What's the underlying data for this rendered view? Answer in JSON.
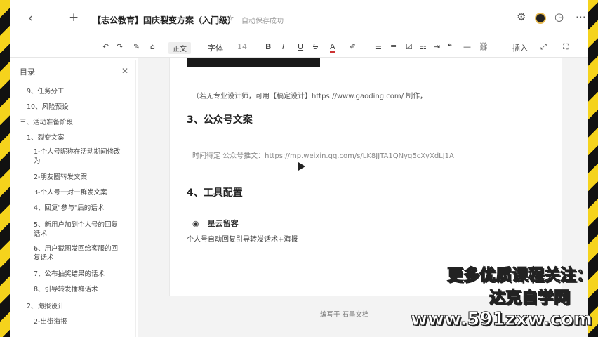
{
  "titlebar": {
    "back_icon": "chevron-left-icon",
    "add_icon": "plus-icon",
    "title": "【志公教育】国庆裂变方案（入门级）",
    "save_status": "自动保存成功"
  },
  "toolbar": {
    "style_select": "正文",
    "font_label": "字体",
    "font_size": "14",
    "insert_label": "插入"
  },
  "sidebar": {
    "header": "目录",
    "items": [
      "9、任务分工",
      "10、风险预设",
      "三、活动准备阶段",
      "1、裂变文案",
      "1-个人号昵称在活动期间修改为",
      "2-朋友圈转发文案",
      "3-个人号一对一群发文案",
      "4、回复\"参与\"后的话术",
      "5、新用户加到个人号的回复话术",
      "6、用户截图发回给客服的回复话术",
      "7、公布抽奖结果的话术",
      "8、引导转发播群话术",
      "2、海报设计",
      "2-出街海报"
    ]
  },
  "document": {
    "note": "（若无专业设计师，可用【稿定设计】https://www.gaoding.com/ 制作，",
    "heading3": "3、公众号文案",
    "link_text": "时间待定  公众号推文：https://mp.weixin.qq.com/s/LK8JJTA1QNyg5cXyXdLJ1A",
    "heading4": "4、工具配置",
    "tool_name": "星云留客",
    "tool_desc": "个人号自动回复引导转发话术+海报",
    "footer": "编写于 石墨文档"
  },
  "watermark": {
    "line1": "更多优质课程关注：",
    "line2": "达克自学网",
    "line3": "www.591zxw.com"
  }
}
